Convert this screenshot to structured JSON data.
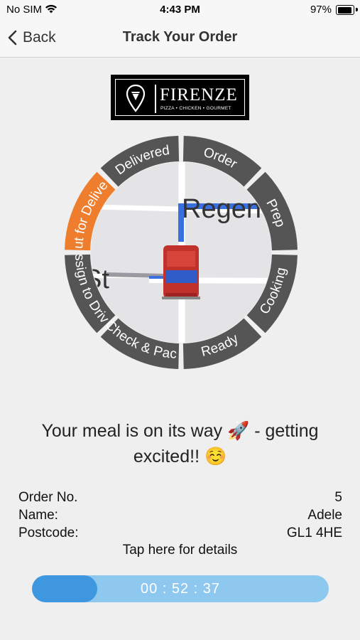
{
  "status_bar": {
    "carrier": "No SIM",
    "time": "4:43 PM",
    "battery": "97%"
  },
  "nav": {
    "back_label": "Back",
    "title": "Track Your Order"
  },
  "logo": {
    "name": "FIRENZE",
    "tagline": "PIZZA • CHICKEN • GOURMET"
  },
  "tracker": {
    "stages": [
      "Order",
      "Prep",
      "Cooking",
      "Ready",
      "Check & Pack",
      "Assign to Driver",
      "Out for Delivery",
      "Delivered"
    ],
    "active_stage": "Out for Delivery",
    "map_labels": [
      "Regen",
      "St"
    ],
    "colors": {
      "ring": "#555555",
      "active": "#ee7d2e",
      "map": "#e4e4e6",
      "route": "#3a6fe0"
    }
  },
  "message": "Your meal is on its way 🚀 - getting excited!! ☺️",
  "order": {
    "rows": [
      {
        "label": "Order No.",
        "value": "5"
      },
      {
        "label": "Name:",
        "value": "Adele"
      },
      {
        "label": "Postcode:",
        "value": "GL1 4HE"
      }
    ],
    "details_link": "Tap here for details"
  },
  "timer": {
    "text": "00 : 52 : 37",
    "progress": 0.22
  }
}
